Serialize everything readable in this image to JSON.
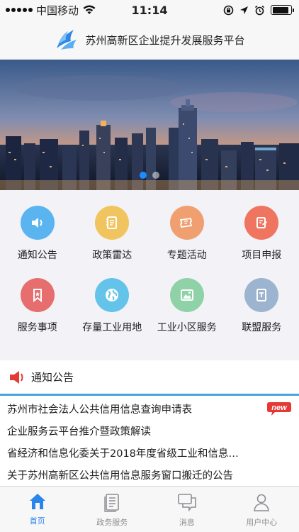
{
  "status_bar": {
    "carrier": "中国移动",
    "time": "11:14",
    "battery_level": 0.9
  },
  "header": {
    "title": "苏州高新区企业提升发展服务平台",
    "logo_icon": "wings-logo-icon"
  },
  "banner": {
    "slide_count": 2,
    "active_slide": 1
  },
  "menu_grid": [
    {
      "label": "通知公告",
      "icon": "speaker-icon",
      "color": "#5ab4f0"
    },
    {
      "label": "政策雷达",
      "icon": "notebook-icon",
      "color": "#f0c560"
    },
    {
      "label": "专题活动",
      "icon": "ticket-icon",
      "color": "#f0a070"
    },
    {
      "label": "项目申报",
      "icon": "edit-document-icon",
      "color": "#ef7560"
    },
    {
      "label": "服务事项",
      "icon": "bookmark-icon",
      "color": "#e76e6e"
    },
    {
      "label": "存量工业用地",
      "icon": "globe-icon",
      "color": "#63c3e9"
    },
    {
      "label": "工业小区服务",
      "icon": "picture-icon",
      "color": "#8fd2a8"
    },
    {
      "label": "联盟服务",
      "icon": "document-icon",
      "color": "#9cb4d0"
    }
  ],
  "notices": {
    "title": "通知公告",
    "badge": "new",
    "items": [
      "苏州市社会法人公共信用信息查询申请表",
      "企业服务云平台推介暨政策解读",
      "省经济和信息化委关于2018年度省级工业和信息…",
      "关于苏州高新区公共信用信息服务窗口搬迁的公告"
    ]
  },
  "tab_bar": {
    "tabs": [
      {
        "label": "首页",
        "icon": "home-icon",
        "active": true
      },
      {
        "label": "政务服务",
        "icon": "list-document-icon",
        "active": false
      },
      {
        "label": "消息",
        "icon": "chat-bubbles-icon",
        "active": false
      },
      {
        "label": "用户中心",
        "icon": "user-icon",
        "active": false
      }
    ]
  }
}
